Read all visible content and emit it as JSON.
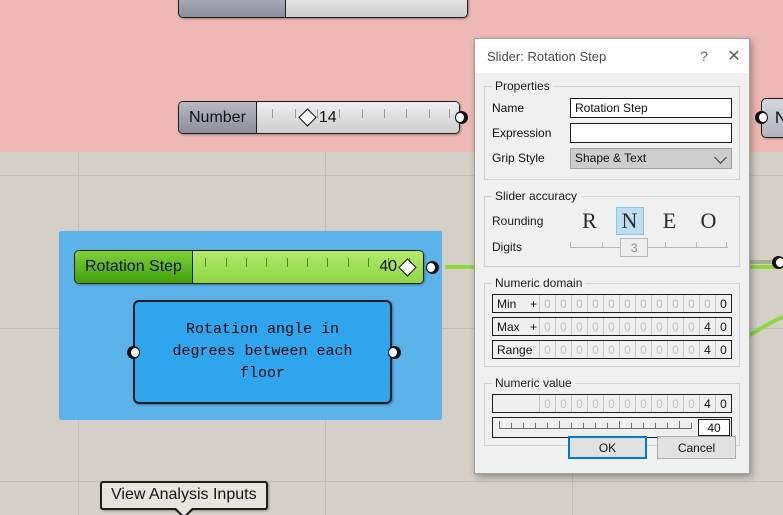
{
  "canvas": {
    "groups": [
      {
        "name": "analysis-inputs-group",
        "color": "#eeb9b5"
      },
      {
        "name": "rotation-step-group",
        "color": "#5cb3ea"
      }
    ],
    "number_slider": {
      "label": "Number",
      "value": "14"
    },
    "rotation_slider": {
      "label": "Rotation Step",
      "value": "40"
    },
    "comment_panel": {
      "text": "Rotation angle in\ndegrees between each\nfloor"
    },
    "callout": {
      "label": "View Analysis Inputs"
    },
    "right_component": {
      "label": "N"
    }
  },
  "dialog": {
    "title": "Slider: Rotation Step",
    "help_icon": "?",
    "close_icon": "✕",
    "properties": {
      "legend": "Properties",
      "name_label": "Name",
      "name_value": "Rotation Step",
      "expression_label": "Expression",
      "expression_value": "",
      "grip_style_label": "Grip Style",
      "grip_style_value": "Shape & Text"
    },
    "accuracy": {
      "legend": "Slider accuracy",
      "rounding_label": "Rounding",
      "rounding_options": [
        "R",
        "N",
        "E",
        "O"
      ],
      "rounding_selected": "N",
      "digits_label": "Digits",
      "digits_value": "3"
    },
    "domain": {
      "legend": "Numeric domain",
      "min_label": "Min",
      "min_sign": "+",
      "min_digits": [
        "0",
        "0",
        "0",
        "0",
        "0",
        "0",
        "0",
        "0",
        "0",
        "0",
        "0",
        "0"
      ],
      "min_significant": 1,
      "max_label": "Max",
      "max_sign": "+",
      "max_digits": [
        "0",
        "0",
        "0",
        "0",
        "0",
        "0",
        "0",
        "0",
        "0",
        "0",
        "4",
        "0"
      ],
      "max_significant": 2,
      "range_label": "Range",
      "range_sign": "",
      "range_digits": [
        "0",
        "0",
        "0",
        "0",
        "0",
        "0",
        "0",
        "0",
        "0",
        "0",
        "4",
        "0"
      ],
      "range_significant": 2
    },
    "numeric_value": {
      "legend": "Numeric value",
      "digits": [
        "0",
        "0",
        "0",
        "0",
        "0",
        "0",
        "0",
        "0",
        "0",
        "0",
        "4",
        "0"
      ],
      "significant": 2,
      "slider_value": "40"
    },
    "buttons": {
      "ok": "OK",
      "cancel": "Cancel"
    },
    "accent": "#0078d7"
  }
}
